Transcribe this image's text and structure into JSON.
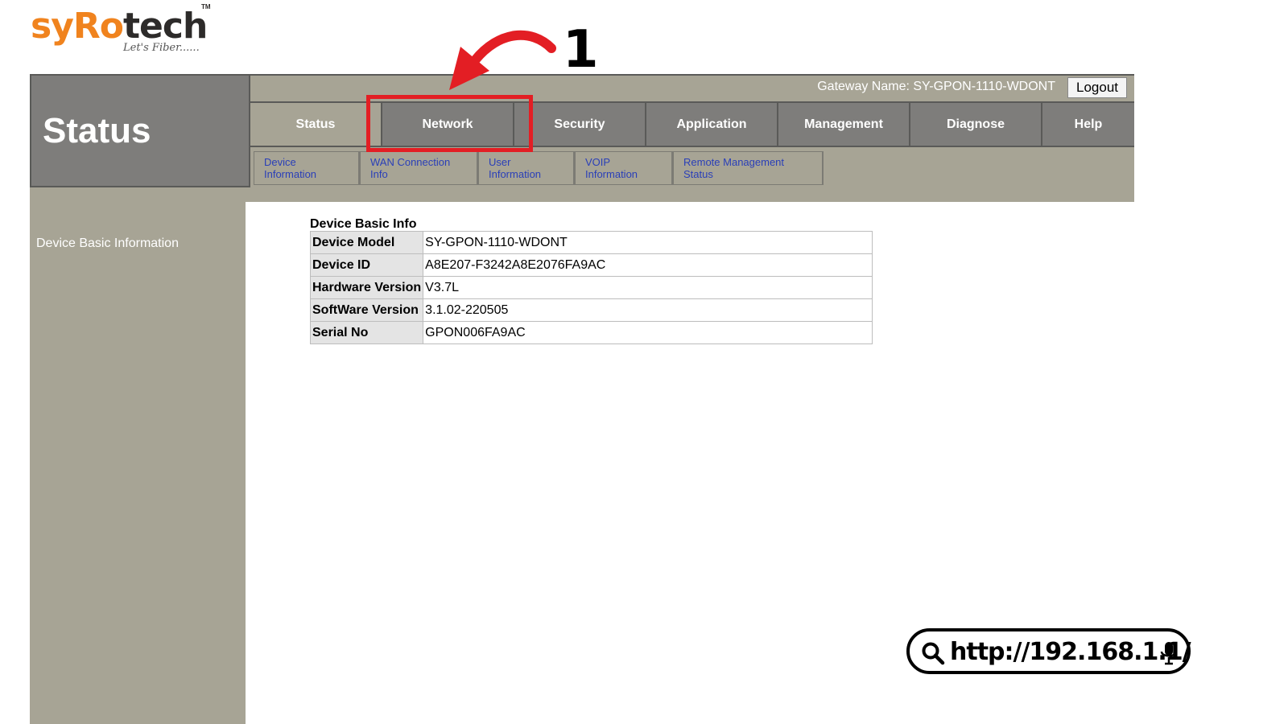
{
  "logo": {
    "part_orange_1": "sy",
    "part_orange_2": "Ro",
    "part_dark": "tech",
    "tm": "TM",
    "tagline": "Let's Fiber......"
  },
  "header": {
    "module_title": "Status",
    "gateway_label": "Gateway Name:  SY-GPON-1110-WDONT",
    "logout_label": "Logout"
  },
  "main_tabs": [
    {
      "label": "Status",
      "active": true
    },
    {
      "label": "Network",
      "active": false
    },
    {
      "label": "Security",
      "active": false
    },
    {
      "label": "Application",
      "active": false
    },
    {
      "label": "Management",
      "active": false
    },
    {
      "label": "Diagnose",
      "active": false
    },
    {
      "label": "Help",
      "active": false
    }
  ],
  "sub_tabs": [
    {
      "label": "Device Information"
    },
    {
      "label": "WAN Connection Info"
    },
    {
      "label": "User Information"
    },
    {
      "label": "VOIP Information"
    },
    {
      "label": "Remote Management Status"
    }
  ],
  "sidebar": {
    "items": [
      {
        "label": "Device Basic Information"
      }
    ]
  },
  "content": {
    "section_title": "Device Basic Info",
    "rows": [
      {
        "key": "Device Model",
        "value": "SY-GPON-1110-WDONT"
      },
      {
        "key": "Device ID",
        "value": "A8E207-F3242A8E2076FA9AC"
      },
      {
        "key": "Hardware Version",
        "value": "V3.7L"
      },
      {
        "key": "SoftWare Version",
        "value": "3.1.02-220505"
      },
      {
        "key": "Serial No",
        "value": "GPON006FA9AC"
      }
    ]
  },
  "annotation": {
    "step_number": "1",
    "highlight_color": "#e31e24",
    "arrow_icon": "curved-arrow-icon"
  },
  "url_bar": {
    "url": "http://192.168.1.1/",
    "left_icon": "search-icon",
    "right_icon": "microphone-icon"
  },
  "colors": {
    "frame_dark": "#7e7d7b",
    "frame_light": "#a7a495",
    "link_blue": "#2a3fb8",
    "logo_orange": "#f0831e"
  }
}
